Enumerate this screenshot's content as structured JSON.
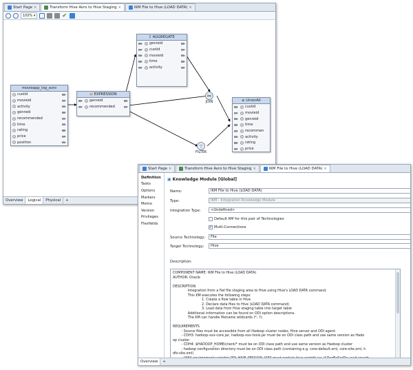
{
  "back_window": {
    "tabs": [
      {
        "label": "Start Page",
        "icon_color": "#3c7fd1"
      },
      {
        "label": "Transform Hive Avro to Hive Staging",
        "icon_color": "#4a8a4a"
      },
      {
        "label": "IKM File to Hive (LOAD DATA)",
        "icon_color": "#3c7fd1"
      }
    ],
    "zoom_value": "100%",
    "source_node": {
      "title": "movieapp_log_avro",
      "attrs": [
        "custid",
        "movieid",
        "activity",
        "genreid",
        "recommended",
        "time",
        "rating",
        "price",
        "position"
      ]
    },
    "expression_node": {
      "title": "EXPRESSION",
      "attrs": [
        "genreid",
        "recommended"
      ]
    },
    "aggregate_node": {
      "title": "AGGREGATE",
      "attrs": [
        "genreid",
        "custid",
        "movieid",
        "time",
        "activity"
      ]
    },
    "join_label": "JOIN",
    "filter_label": "FILTER",
    "union_node": {
      "title": "UnionAll",
      "attrs": [
        "custid",
        "movieid",
        "genreid",
        "time",
        "recommen",
        "activity",
        "rating",
        "price"
      ]
    },
    "bottom_tabs": [
      "Overview",
      "Logical",
      "Physical"
    ]
  },
  "front_window": {
    "tabs": [
      {
        "label": "Start Page",
        "icon_color": "#3c7fd1"
      },
      {
        "label": "Transform Hive Avro to Hive Staging",
        "icon_color": "#4a8a4a"
      },
      {
        "label": "IKM File to Hive (LOAD DATA)",
        "icon_color": "#3c7fd1"
      }
    ],
    "nav_items": [
      "Definition",
      "Tasks",
      "Options",
      "Markers",
      "Memo",
      "Version",
      "Privileges",
      "Flexfields"
    ],
    "header": "Knowledge Module [Global]",
    "labels": {
      "name": "Name:",
      "type": "Type:",
      "integration_type": "Integration Type:",
      "source_tech": "Source Technology:",
      "target_tech": "Target Technology:",
      "description": "Description:"
    },
    "values": {
      "name": "IKM File to Hive (LOAD DATA)",
      "type": "IKM - Integration Knowledge Module",
      "integration_type": "<Undefined>",
      "source_tech": "File",
      "target_tech": "Hive"
    },
    "checkboxes": {
      "default_km": {
        "label": "Default KM for this pair of Technologies",
        "checked": false
      },
      "multi_conn": {
        "label": "Multi-Connections",
        "checked": true
      }
    },
    "description_text": "COMPONENT NAME: IKM File to Hive (LOAD DATA)\nAUTHOR: Oracle\n\nDESCRIPTION\n              Integration from a flat file staging area to Hive using Hive's LOAD DATA command.\n              This KM executes the following steps:\n                           1. Create a flow table in Hive\n                           2. Declare data files to Hive (LOAD DATA command)\n                           3. Load data from Hive staging table into target table\n              Additional information can be found on ODI option descriptions.\n              The KM can handle filename wildcards (*, ?).\n\nREQUIREMENTS\n        - Source files must be accessible from all Hadoop cluster nodes, Hive server and ODI agent.\n        - CDH3: hadoop-xxx-core.jar, hadoop-xxx-tools.jar must be on ODI class path and use same version as Hado\nop cluster\n        - CDH4: $HADOOP_HOME/client/* must be on ODI class path and use same version as Hadoop cluster\n        - hadoop configuration directory must be on ODI class path (containing e.g. core-default.xml, core-site.xml, h\ndfs-site.xml)\n        - UNIX environment variable ODI_HIVE_SESSION_JARS must contain hive-contrib.jar, if RegExSerDe used anywh\nere;",
    "bottom_tabs": [
      "Overview"
    ]
  }
}
